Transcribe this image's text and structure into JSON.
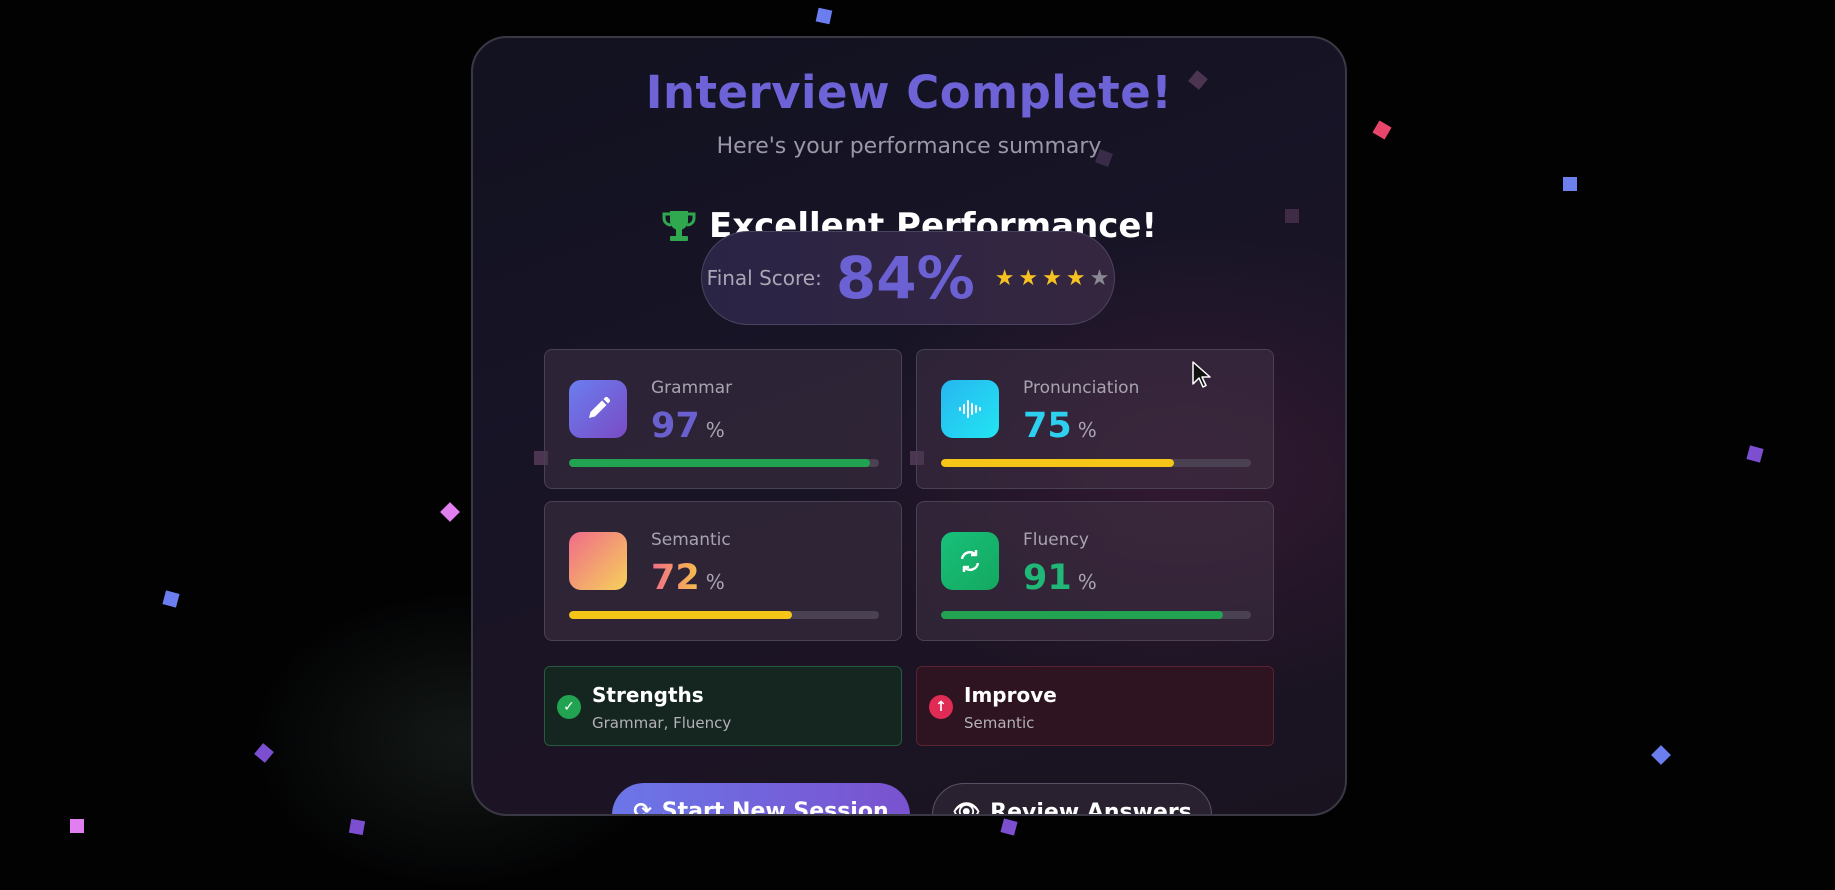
{
  "header": {
    "title": "Interview Complete!",
    "subtitle": "Here's your performance summary",
    "performance": "Excellent Performance!"
  },
  "score": {
    "label": "Final Score:",
    "value": "84%",
    "stars_filled": 4,
    "stars_total": 5
  },
  "metrics": [
    {
      "label": "Grammar",
      "value": "97",
      "unit": "%",
      "progress": 0.97,
      "bar_color": "#22a352",
      "value_color": "#6a5fcf",
      "icon": "pencil-icon"
    },
    {
      "label": "Pronunciation",
      "value": "75",
      "unit": "%",
      "progress": 0.75,
      "bar_color": "#f5c518",
      "value_color": "#2ed0f0",
      "icon": "sound-wave-icon"
    },
    {
      "label": "Semantic",
      "value": "72",
      "unit": "%",
      "progress": 0.72,
      "bar_color": "#f5c518",
      "value_color": "#f28c6b",
      "icon": "blank-gradient-icon"
    },
    {
      "label": "Fluency",
      "value": "91",
      "unit": "%",
      "progress": 0.91,
      "bar_color": "#22a352",
      "value_color": "#1fb877",
      "icon": "refresh-icon"
    }
  ],
  "feedback": {
    "strengths": {
      "title": "Strengths",
      "text": "Grammar, Fluency",
      "icon": "check-circle-icon"
    },
    "improve": {
      "title": "Improve",
      "text": "Semantic",
      "icon": "arrow-up-circle-icon"
    }
  },
  "buttons": {
    "new_session": "Start New Session",
    "review": "Review Answers"
  },
  "colors": {
    "accent": "#6b61d2",
    "success": "#22a352",
    "warning": "#f5c518",
    "danger": "#e02b55"
  }
}
